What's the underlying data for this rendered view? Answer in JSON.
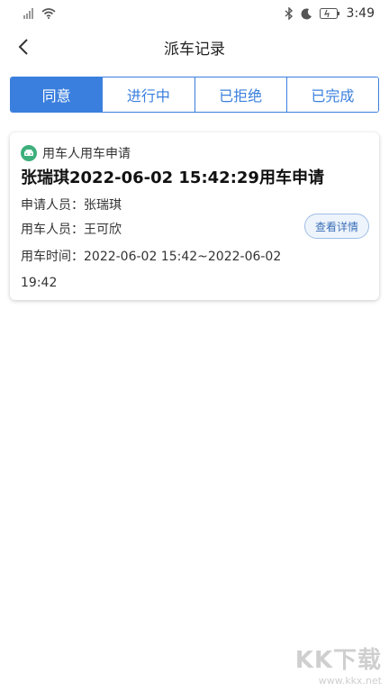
{
  "status_bar": {
    "time": "3:49"
  },
  "header": {
    "title": "派车记录"
  },
  "tabs": [
    {
      "label": "同意",
      "active": true
    },
    {
      "label": "进行中",
      "active": false
    },
    {
      "label": "已拒绝",
      "active": false
    },
    {
      "label": "已完成",
      "active": false
    }
  ],
  "card": {
    "type_label": "用车人用车申请",
    "title": "张瑞琪2022-06-02 15:42:29用车申请",
    "applicant_label": "申请人员：",
    "applicant": "张瑞琪",
    "user_label": "用车人员：",
    "user": "王可欣",
    "time_label": "用车时间：",
    "time_value": "2022-06-02 15:42~2022-06-02 19:42",
    "detail_button": "查看详情"
  },
  "watermark": {
    "logo": "KK下载",
    "url": "www.kkx.net"
  },
  "colors": {
    "primary": "#3a7fdd",
    "type_icon": "#3daf7b"
  }
}
